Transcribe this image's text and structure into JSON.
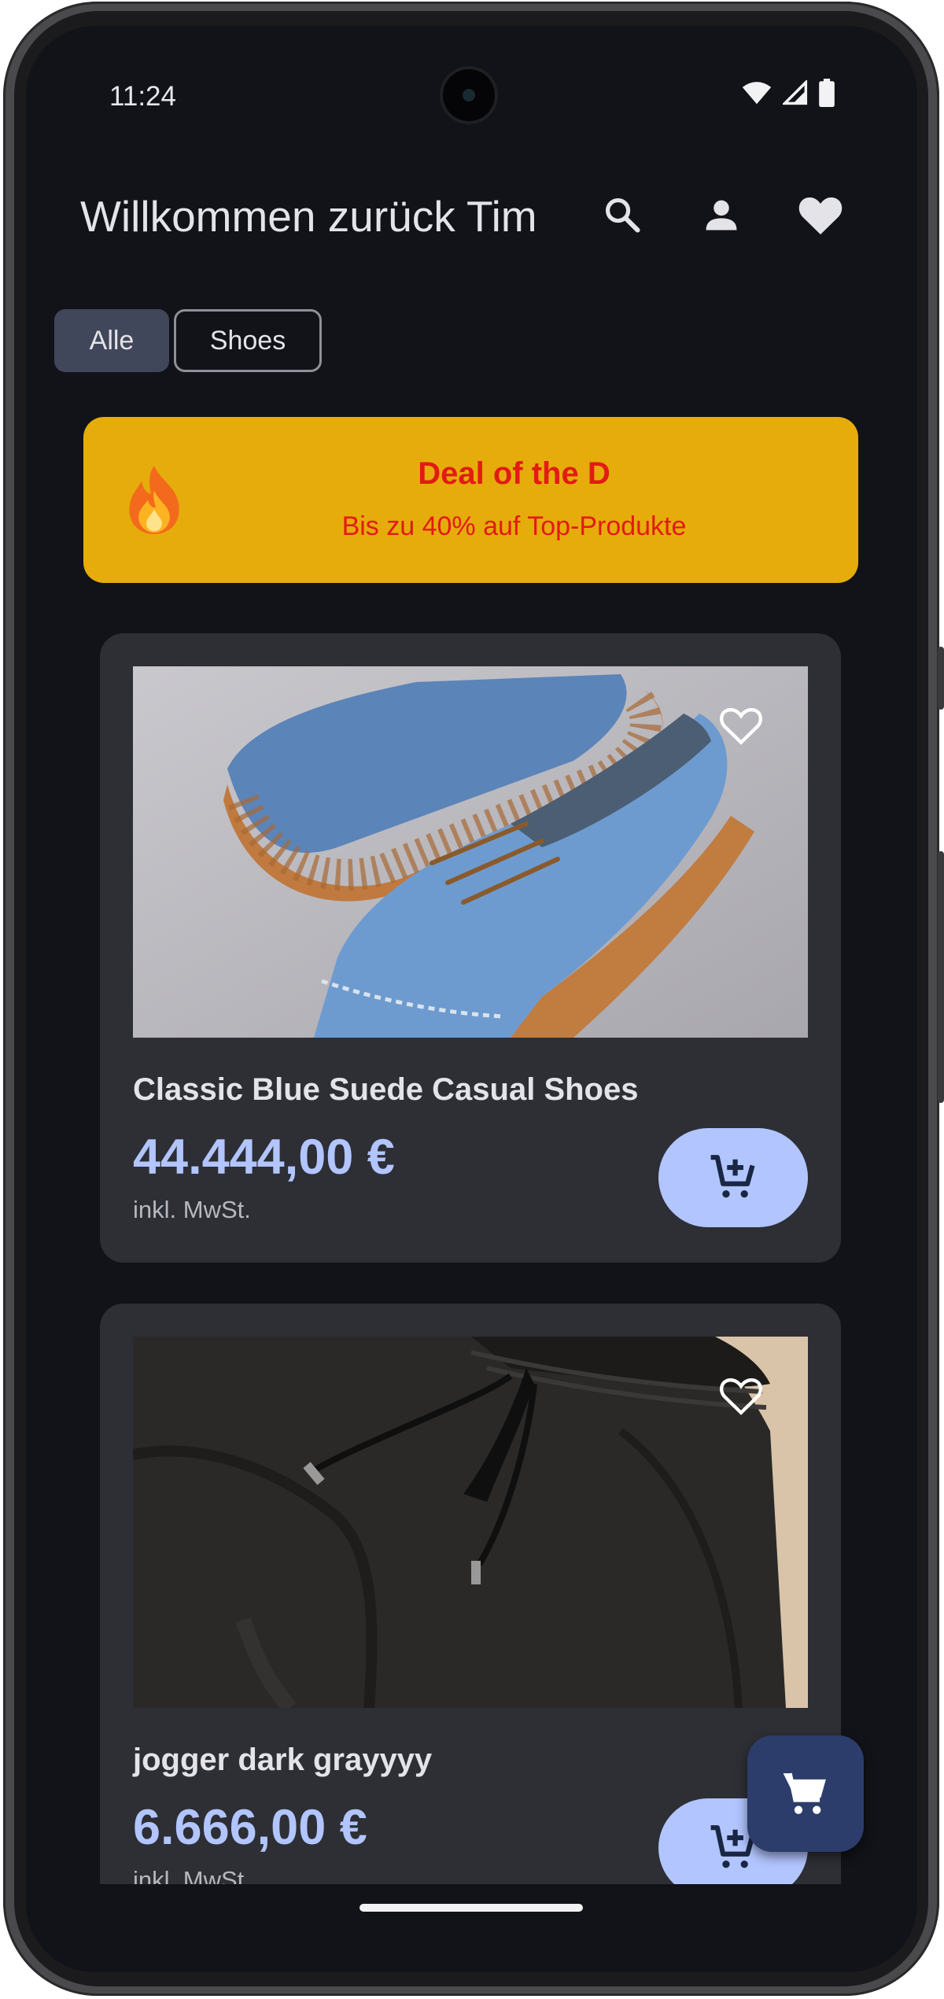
{
  "status_bar": {
    "time": "11:24",
    "icons": [
      "wifi-icon",
      "signal-icon",
      "battery-icon"
    ]
  },
  "app_bar": {
    "title": "Willkommen zurück Tim",
    "actions": [
      "search-icon",
      "account-icon",
      "favorites-icon"
    ]
  },
  "chips": [
    {
      "label": "Alle",
      "selected": true
    },
    {
      "label": "Shoes",
      "selected": false
    }
  ],
  "deal": {
    "emoji": "fire-emoji",
    "title": "Deal of the D",
    "subtitle": "Bis zu 40% auf Top-Produkte"
  },
  "products": [
    {
      "name": "Classic Blue Suede Casual Shoes",
      "price": "44.444,00 €",
      "tax": "inkl. MwSt.",
      "image": "blue-suede-shoes-photo",
      "favorite": false
    },
    {
      "name": "jogger dark grayyyy",
      "price": "6.666,00 €",
      "tax": "inkl. MwSt.",
      "image": "dark-jogger-pants-photo",
      "favorite": false
    }
  ],
  "fab": {
    "icon": "cart-icon"
  },
  "colors": {
    "background": "#111318",
    "card": "#2d2f35",
    "accent": "#b2c5ff",
    "deal_bg": "#e6ac0b",
    "deal_text": "#e21b14",
    "fab": "#2c3d6c"
  }
}
